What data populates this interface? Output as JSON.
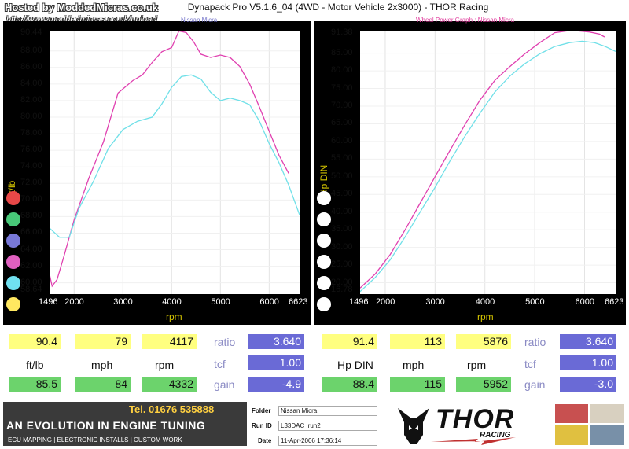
{
  "watermark": {
    "line1": "Hosted by ModdedMicras.co.uk",
    "line2": "http://www.moddedmicras.co.uk/upload"
  },
  "app_title": "Dynapack Pro V5.1.6_04 (4WD - Motor Vehicle 2x3000) - THOR Racing",
  "colors": {
    "torque_pink": "#e040b0",
    "torque_cyan": "#70e0e8",
    "frame": "#000000",
    "axis_title": "#d4c400",
    "yellow_box": "#ffff80",
    "green_box": "#6cd36c",
    "blue_box": "#6a6ad6"
  },
  "legend_dots": [
    {
      "color": "#e84848",
      "value": "70.00"
    },
    {
      "color": "#48c878",
      "value": "68.00"
    },
    {
      "color": "#7878d8",
      "value": "66.00"
    },
    {
      "color": "#e060c0",
      "value": "62.00"
    },
    {
      "color": "#70e0f0",
      "value": ""
    },
    {
      "color": "#ffe860",
      "value": ""
    }
  ],
  "chart_data": [
    {
      "type": "line",
      "title": "Nissan Micra",
      "xlabel": "rpm",
      "ylabel": "ft/lb",
      "xlim": [
        1496,
        6623
      ],
      "ylim": [
        58.64,
        90.44
      ],
      "x_ticks": [
        "1496",
        "2000",
        "3000",
        "4000",
        "5000",
        "6000",
        "6623"
      ],
      "y_ticks": [
        "90.44",
        "88.00",
        "86.00",
        "84.00",
        "82.00",
        "80.00",
        "78.00",
        "76.00",
        "74.00",
        "72.00",
        "70.00",
        "68.00",
        "66.00",
        "64.00",
        "62.00",
        "60.00",
        "58.64"
      ],
      "series": [
        {
          "color": "#e040b0",
          "x": [
            1496,
            1550,
            1650,
            1800,
            2000,
            2300,
            2600,
            2900,
            3200,
            3400,
            3600,
            3800,
            4000,
            4150,
            4300,
            4450,
            4600,
            4800,
            5000,
            5200,
            5400,
            5600,
            5800,
            6000,
            6200,
            6400
          ],
          "y": [
            61.0,
            59.6,
            60.4,
            63.4,
            67.6,
            72.6,
            77.0,
            82.9,
            84.4,
            85.1,
            86.6,
            87.9,
            88.4,
            90.4,
            90.2,
            89.1,
            87.6,
            87.2,
            87.5,
            87.2,
            86.1,
            84.0,
            81.2,
            78.3,
            75.4,
            73.2
          ]
        },
        {
          "color": "#70e0e8",
          "x": [
            1496,
            1700,
            1900,
            2100,
            2400,
            2700,
            3000,
            3300,
            3600,
            3800,
            4000,
            4200,
            4400,
            4600,
            4800,
            5000,
            5200,
            5400,
            5600,
            5800,
            6000,
            6200,
            6400,
            6623
          ],
          "y": [
            66.6,
            65.5,
            65.5,
            69.0,
            72.3,
            76.2,
            78.5,
            79.5,
            80.0,
            81.6,
            83.6,
            84.9,
            85.1,
            84.6,
            83.0,
            82.0,
            82.3,
            82.0,
            81.5,
            79.5,
            76.8,
            74.5,
            71.8,
            68.2
          ]
        }
      ]
    },
    {
      "type": "line",
      "title": "Wheel Power Graph : Nissan Micra",
      "xlabel": "rpm",
      "ylabel": "Hp DIN",
      "xlim": [
        1496,
        6623
      ],
      "ylim": [
        16.78,
        91.38
      ],
      "x_ticks": [
        "1496",
        "2000",
        "3000",
        "4000",
        "5000",
        "6000",
        "6623"
      ],
      "y_ticks": [
        "91.38",
        "85.00",
        "80.00",
        "75.00",
        "70.00",
        "65.00",
        "60.00",
        "55.00",
        "50.00",
        "45.00",
        "40.00",
        "35.00",
        "30.00",
        "25.00",
        "20.00",
        "16.78"
      ],
      "series": [
        {
          "color": "#e040b0",
          "x": [
            1496,
            1800,
            2100,
            2400,
            2700,
            3000,
            3300,
            3600,
            3900,
            4200,
            4500,
            4800,
            5100,
            5400,
            5700,
            5876,
            6100,
            6300,
            6400
          ],
          "y": [
            18.5,
            22.5,
            28.0,
            35.0,
            42.5,
            50.0,
            57.5,
            64.8,
            71.7,
            77.3,
            81.2,
            84.8,
            88.0,
            90.8,
            91.4,
            91.3,
            91.0,
            90.4,
            89.6
          ]
        },
        {
          "color": "#70e0e8",
          "x": [
            1496,
            1800,
            2100,
            2400,
            2700,
            3000,
            3300,
            3600,
            3900,
            4200,
            4500,
            4800,
            5100,
            5400,
            5700,
            5952,
            6200,
            6400,
            6623
          ],
          "y": [
            17.5,
            21.5,
            26.5,
            33.0,
            40.0,
            47.0,
            54.5,
            61.5,
            68.0,
            74.0,
            78.5,
            82.0,
            84.8,
            86.9,
            88.0,
            88.4,
            88.0,
            87.0,
            85.5
          ]
        }
      ]
    }
  ],
  "left_readout": {
    "top": [
      "90.4",
      "79",
      "4117"
    ],
    "labels": [
      "ft/lb",
      "mph",
      "rpm"
    ],
    "bottom": [
      "85.5",
      "84",
      "4332"
    ],
    "ratio_label": "ratio",
    "ratio": "3.640",
    "tcf_label": "tcf",
    "tcf": "1.00",
    "gain_label": "gain",
    "gain": "-4.9"
  },
  "right_readout": {
    "top": [
      "91.4",
      "113",
      "5876"
    ],
    "labels": [
      "Hp DIN",
      "mph",
      "rpm"
    ],
    "bottom": [
      "88.4",
      "115",
      "5952"
    ],
    "ratio_label": "ratio",
    "ratio": "3.640",
    "tcf_label": "tcf",
    "tcf": "1.00",
    "gain_label": "gain",
    "gain": "-3.0"
  },
  "banner": {
    "phone": "Tel. 01676 535888",
    "slogan": "AN EVOLUTION IN ENGINE TUNING",
    "services": "ECU MAPPING | ELECTRONIC INSTALLS | CUSTOM WORK",
    "folder_label": "Folder",
    "folder": "Nissan Micra",
    "runid_label": "Run ID",
    "runid": "L33DAC_run2",
    "date_label": "Date",
    "date": "11-Apr-2006   17:36:14",
    "brand": "THOR",
    "brand_sub": "RACING"
  }
}
